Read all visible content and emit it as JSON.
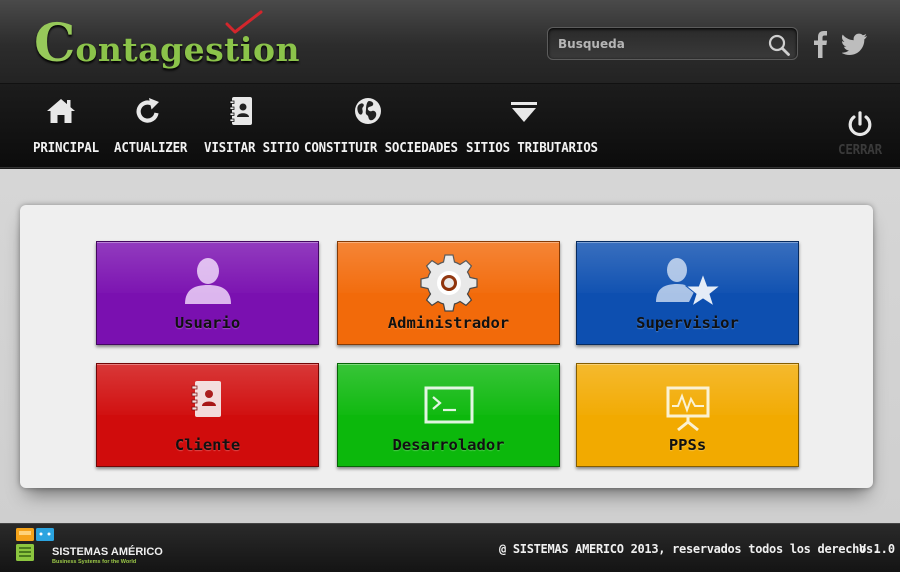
{
  "header": {
    "logo_initial": "C",
    "logo_rest": "ontagestion",
    "search_placeholder": "Busqueda",
    "social": [
      "facebook-icon",
      "twitter-icon"
    ]
  },
  "nav": {
    "items": [
      {
        "label": "PRINCIPAL",
        "icon": "home-icon"
      },
      {
        "label": "ACTUALIZER",
        "icon": "refresh-icon"
      },
      {
        "label": "VISITAR SITIO",
        "icon": "address-book-icon"
      },
      {
        "label": "CONSTITUIR SOCIEDADES",
        "icon": "globe-icon"
      },
      {
        "label": "SITIOS TRIBUTARIOS",
        "icon": "dropdown-triangle-icon"
      }
    ],
    "close_label": "CERRAR",
    "close_icon": "power-icon"
  },
  "tiles": [
    {
      "label": "Usuario",
      "icon": "user-icon",
      "color": "#7a10b0"
    },
    {
      "label": "Administrador",
      "icon": "gear-icon",
      "color": "#f26a0a"
    },
    {
      "label": "Supervisior",
      "icon": "user-star-icon",
      "color": "#0d4fb0"
    },
    {
      "label": "Cliente",
      "icon": "contact-card-icon",
      "color": "#d00c0c"
    },
    {
      "label": "Desarrolador",
      "icon": "terminal-icon",
      "color": "#0cb80c"
    },
    {
      "label": "PPSs",
      "icon": "presentation-chart-icon",
      "color": "#f2aa00"
    }
  ],
  "footer": {
    "brand": "SISTEMAS AMÉRICO",
    "tagline": "Business Systems for the World",
    "copyright": "@ SISTEMAS AMERICO 2013, reservados todos los derechos.",
    "version": "V 1.0"
  }
}
